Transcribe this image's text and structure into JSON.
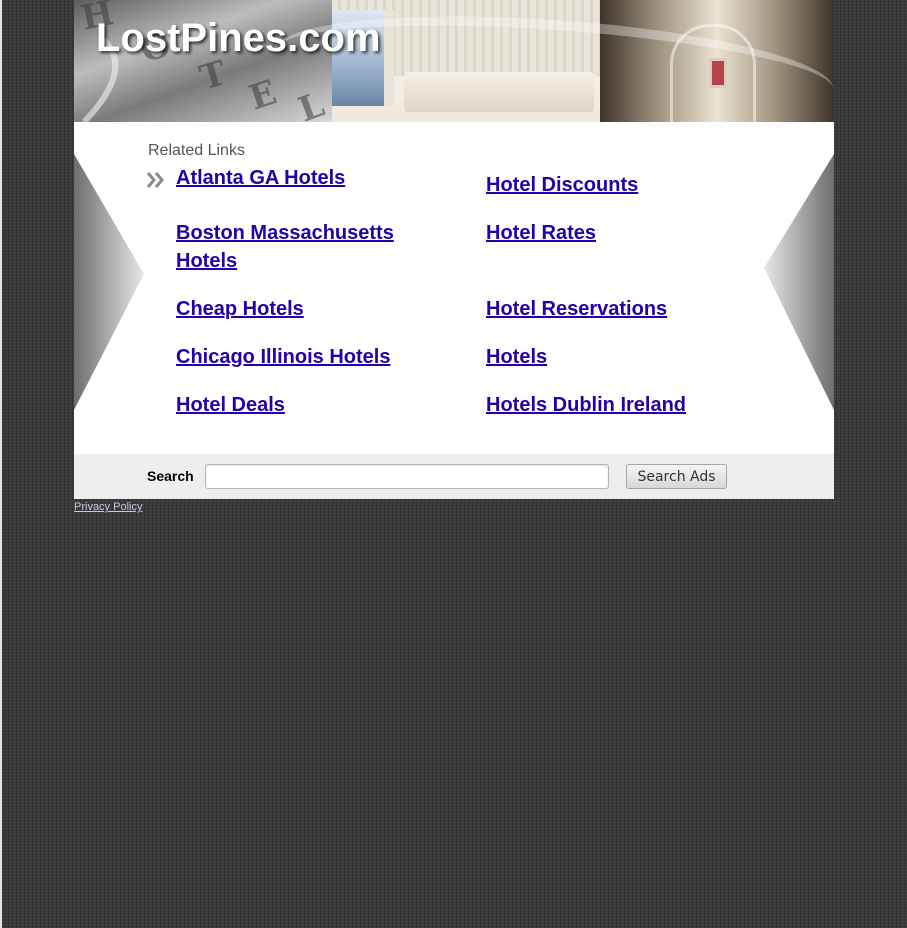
{
  "site": {
    "title": "LostPines.com"
  },
  "related": {
    "heading": "Related Links",
    "links_left": [
      "Atlanta GA Hotels",
      "Boston Massachusetts Hotels",
      "Cheap Hotels",
      "Chicago Illinois Hotels",
      "Hotel Deals"
    ],
    "links_right": [
      "Hotel Discounts",
      "Hotel Rates",
      "Hotel Reservations",
      "Hotels",
      "Hotels Dublin Ireland"
    ]
  },
  "search": {
    "label": "Search",
    "input_value": "",
    "button_label": "Search Ads"
  },
  "footer": {
    "privacy_label": "Privacy Policy"
  },
  "colors": {
    "link": "#2200aa",
    "page_background": "#3a3a3a",
    "panel": "#ffffff",
    "search_bar": "#eeeeee"
  },
  "icons": {
    "link_bullet": "double-chevron-right-icon"
  }
}
